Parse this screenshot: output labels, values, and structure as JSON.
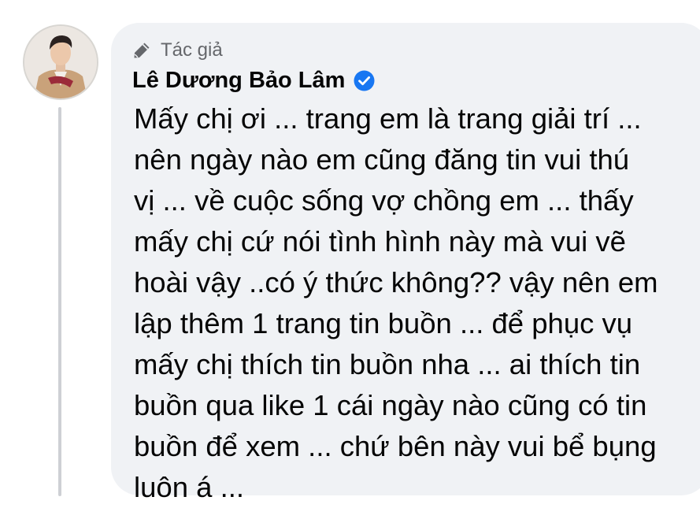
{
  "comment": {
    "author_role": "Tác giả",
    "author_name": "Lê Dương Bảo Lâm",
    "verified": true,
    "lines": [
      "Mấy chị ơi ... trang em là trang giải trí ...",
      "nên ngày nào em cũng đăng tin vui thú",
      "vị ... về cuộc sống vợ chồng em ... thấy",
      "mấy chị cứ nói tình hình này mà vui vẽ",
      "hoài vậy ..có ý thức không?? vậy nên em",
      "lập thêm 1 trang tin buồn ... để phục vụ",
      "mấy chị thích tin buồn nha ... ai thích tin",
      "buồn qua like 1 cái ngày nào cũng có tin",
      "buồn để xem ... chứ bên này vui bể bụng",
      "luôn á ..."
    ]
  },
  "icons": {
    "role": "pencil-icon",
    "verified": "verified-badge-icon",
    "avatar": "profile-photo"
  },
  "colors": {
    "bubble_background": "#f0f2f5",
    "verified_badge": "#1877f2",
    "muted_text": "#65676b",
    "text": "#050505",
    "thread_line": "#ced0d4"
  }
}
